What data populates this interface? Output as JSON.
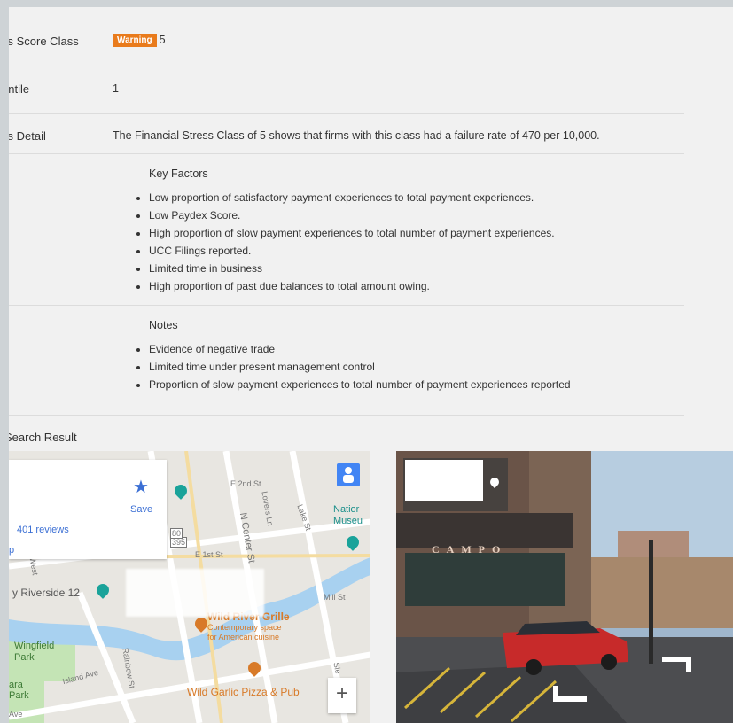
{
  "rows": {
    "score_class": {
      "label": "ss Score Class",
      "badge": "Warning",
      "value": "5"
    },
    "percentile": {
      "label": "entile",
      "value": "1"
    },
    "detail": {
      "label": "ss Detail",
      "value": "The Financial Stress Class of 5 shows that firms with this class had a failure rate of 470 per 10,000."
    }
  },
  "key_factors": {
    "title": "Key Factors",
    "items": [
      "Low proportion of satisfactory payment experiences to total payment experiences.",
      "Low Paydex Score.",
      "High proportion of slow payment experiences to total number of payment experiences.",
      "UCC Filings reported.",
      "Limited time in business",
      "High proportion of past due balances to total amount owing."
    ]
  },
  "notes": {
    "title": "Notes",
    "items": [
      "Evidence of negative trade",
      "Limited time under present management control",
      "Proportion of slow payment experiences to total number of payment experiences reported"
    ]
  },
  "search_result_label": "Search Result",
  "map": {
    "reviews": "401 reviews",
    "save": "Save",
    "partial_link": "p",
    "zoom_in": "+",
    "labels": {
      "riverside": "y Riverside 12",
      "wingfield": "Wingfield\nPark",
      "island_park": "ara\nPark",
      "national_museum": "Natior\nMuseu",
      "wild_river": "Wild River Grille",
      "wild_river_sub1": "Contemporary space",
      "wild_river_sub2": "for American cuisine",
      "wild_garlic": "Wild Garlic Pizza & Pub"
    },
    "streets": {
      "e2nd": "E 2nd St",
      "e1st": "E 1st St",
      "ncenter": "N Center St",
      "lovers": "Lovers Ln",
      "lake": "Lake St",
      "mill": "Mill St",
      "island": "Island Ave",
      "rainbow": "Rainbow St",
      "sierra": "Sie",
      "west": "West",
      "ave": "Ave",
      "r395": "395",
      "r80": "80"
    }
  },
  "streetview": {
    "sign": "CAMPO"
  },
  "colors": {
    "badge": "#e97b1c",
    "link": "#3b6fd4",
    "poi": "#d87a28",
    "water": "#a8d1f0",
    "park": "#c4e4b5"
  }
}
